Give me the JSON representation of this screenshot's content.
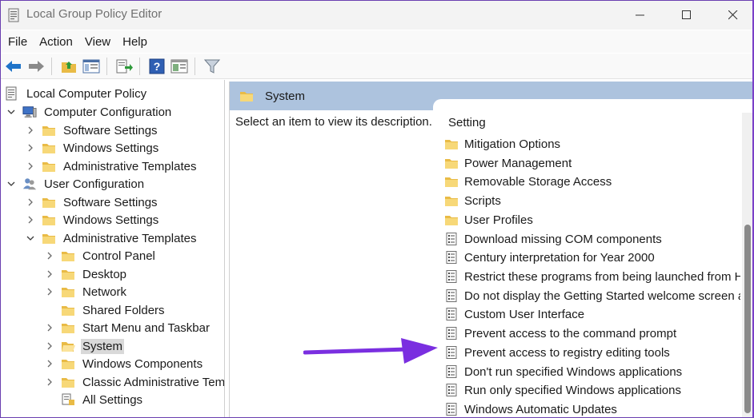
{
  "window": {
    "title": "Local Group Policy Editor",
    "accent": "#adc3de"
  },
  "menu": {
    "items": [
      "File",
      "Action",
      "View",
      "Help"
    ]
  },
  "toolbar": {
    "icons": [
      "back-arrow-icon",
      "forward-arrow-icon",
      "up-folder-icon",
      "show-hide-tree-icon",
      "export-list-icon",
      "help-icon",
      "properties-icon",
      "filter-icon"
    ]
  },
  "tree": {
    "root": "Local Computer Policy",
    "computer_config": "Computer Configuration",
    "cc_software": "Software Settings",
    "cc_windows": "Windows Settings",
    "cc_admin": "Administrative Templates",
    "user_config": "User Configuration",
    "uc_software": "Software Settings",
    "uc_windows": "Windows Settings",
    "uc_admin": "Administrative Templates",
    "control_panel": "Control Panel",
    "desktop": "Desktop",
    "network": "Network",
    "shared_folders": "Shared Folders",
    "start_menu": "Start Menu and Taskbar",
    "system": "System",
    "windows_components": "Windows Components",
    "classic_admin": "Classic Administrative Templates",
    "all_settings": "All Settings"
  },
  "right": {
    "header": "System",
    "description": "Select an item to view its description.",
    "column_header": "Setting",
    "folders": [
      "Mitigation Options",
      "Power Management",
      "Removable Storage Access",
      "Scripts",
      "User Profiles"
    ],
    "settings": [
      "Download missing COM components",
      "Century interpretation for Year 2000",
      "Restrict these programs from being launched from Help",
      "Do not display the Getting Started welcome screen at logon",
      "Custom User Interface",
      "Prevent access to the command prompt",
      "Prevent access to registry editing tools",
      "Don't run specified Windows applications",
      "Run only specified Windows applications",
      "Windows Automatic Updates"
    ]
  },
  "annotation": {
    "arrow_color": "#7a2fe0"
  }
}
